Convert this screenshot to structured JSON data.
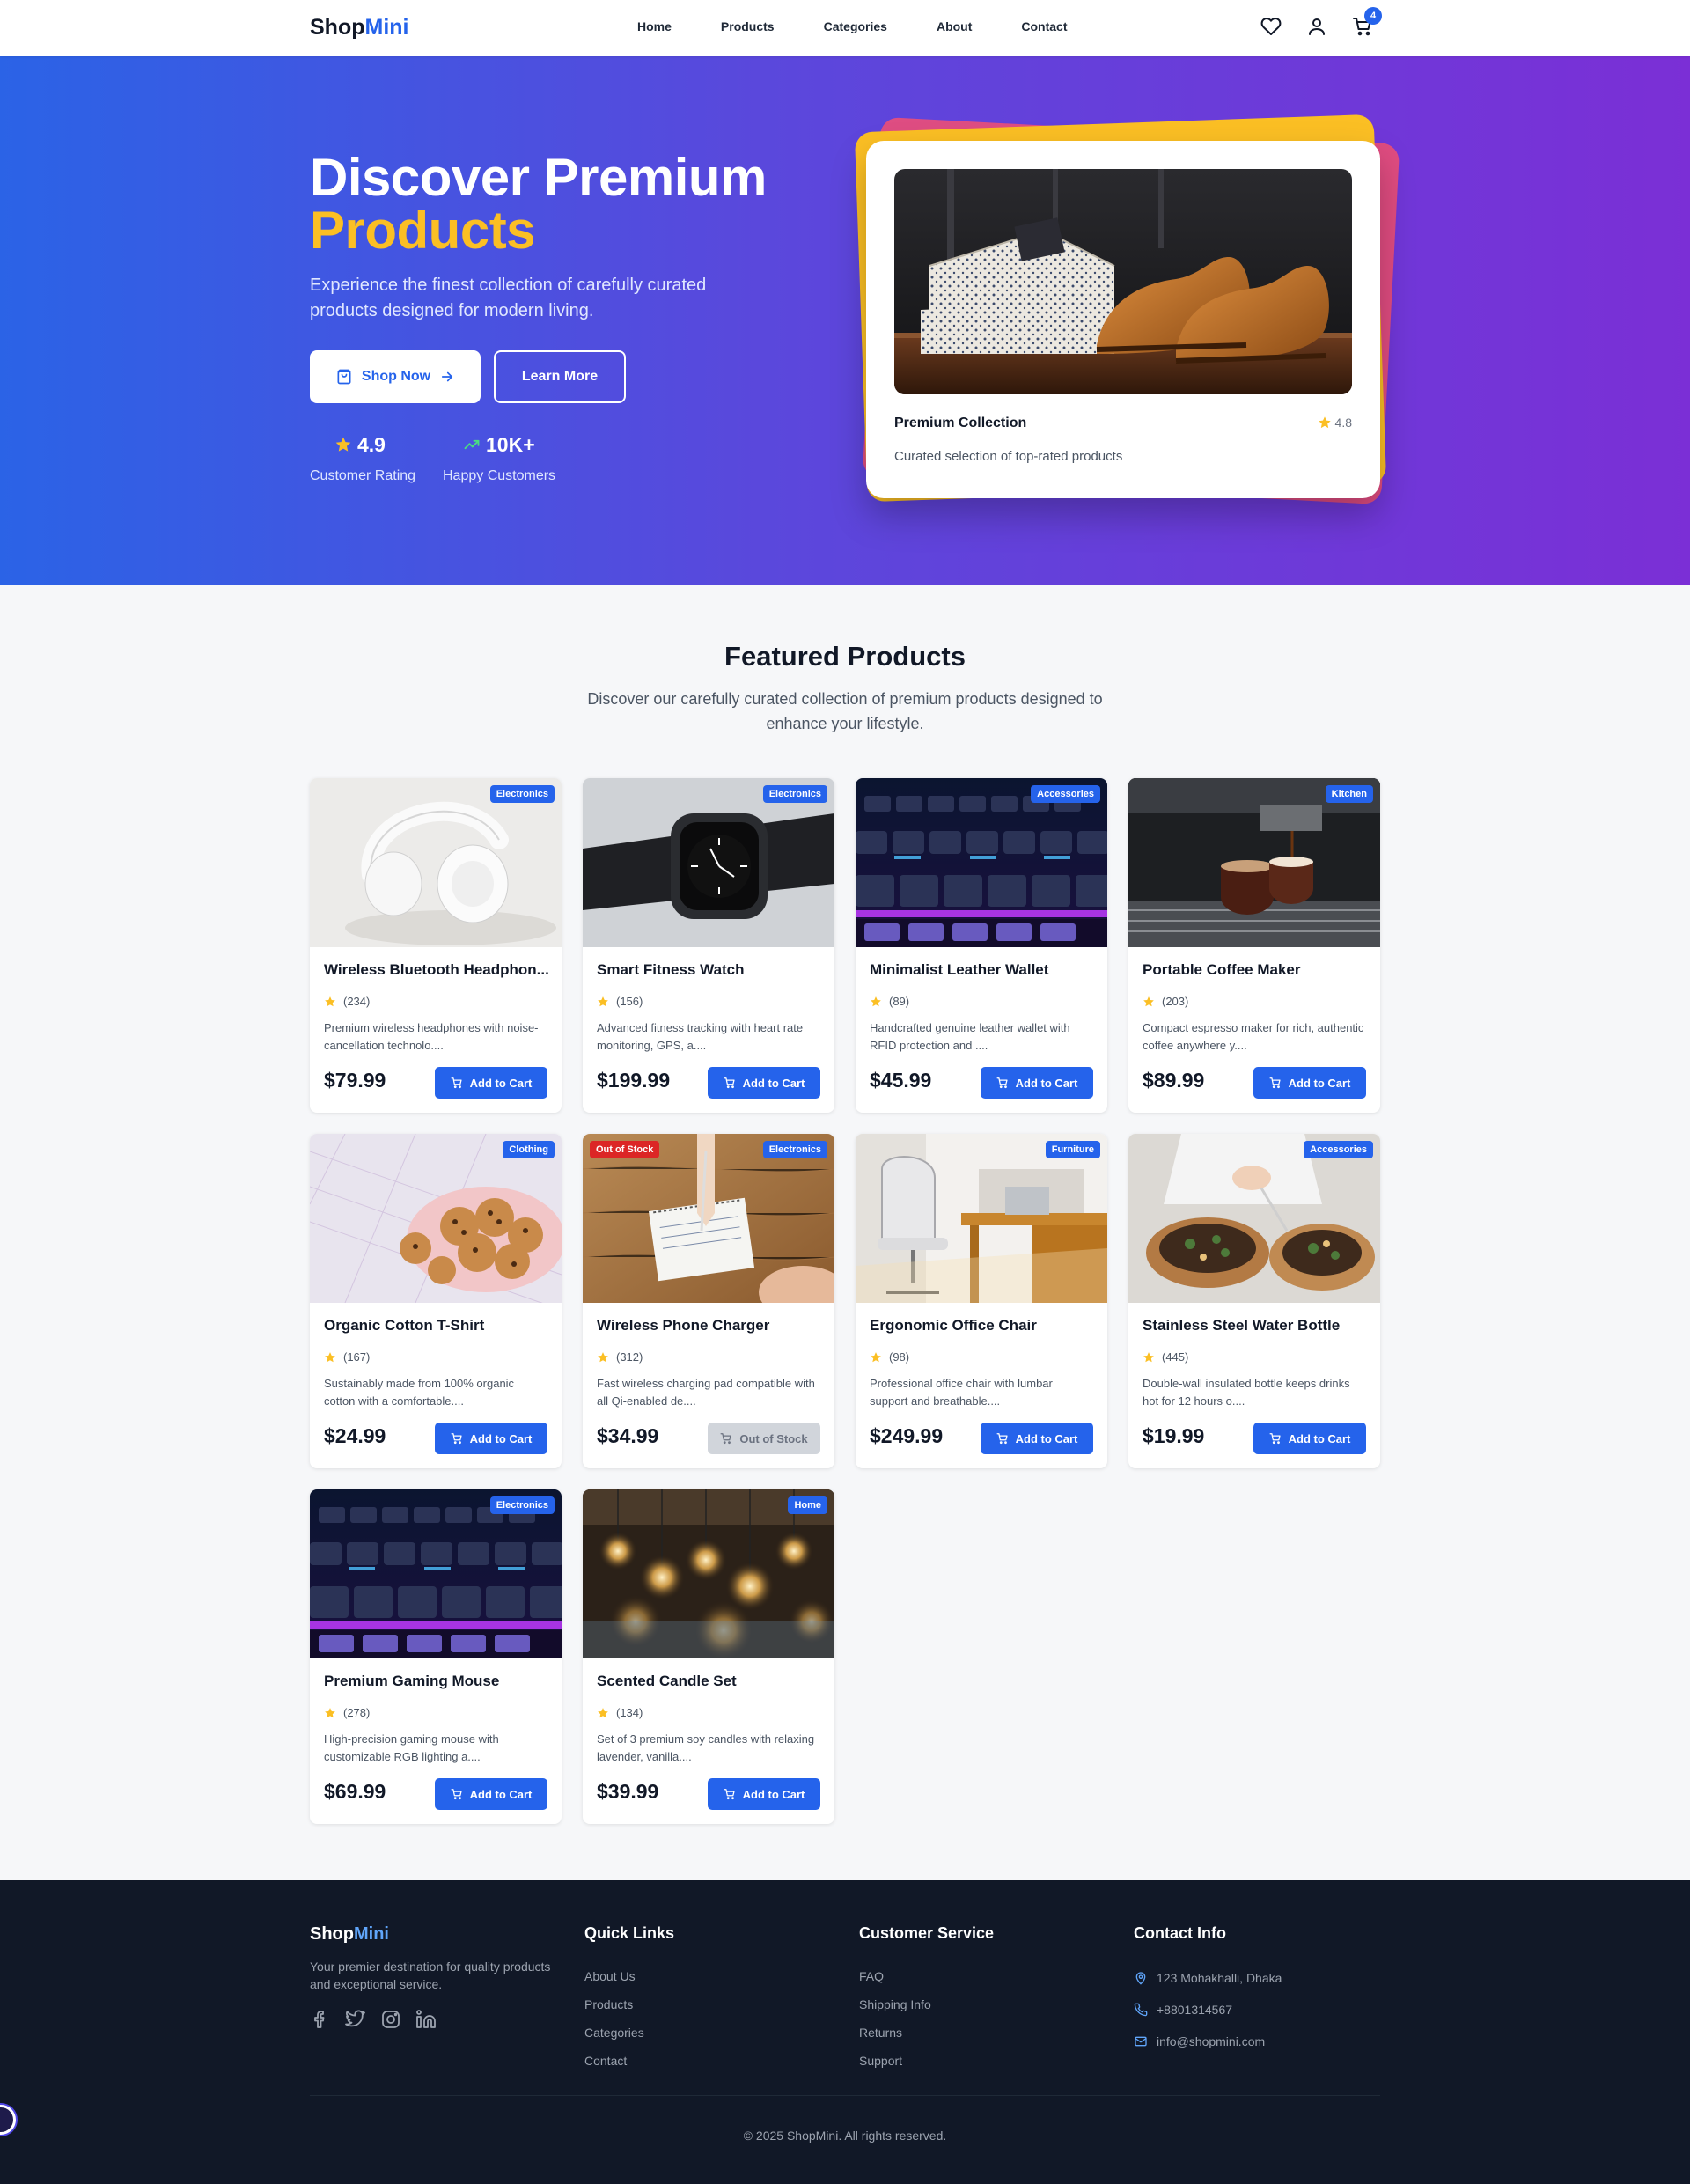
{
  "nav": {
    "logo_part1": "Shop",
    "logo_part2": "Mini",
    "links": [
      "Home",
      "Products",
      "Categories",
      "About",
      "Contact"
    ],
    "cart_count": "4"
  },
  "hero": {
    "title_line1": "Discover Premium",
    "title_line2": "Products",
    "subtitle": "Experience the finest collection of carefully curated products designed for modern living.",
    "shop_now": "Shop Now",
    "learn_more": "Learn More",
    "stat1_value": "4.9",
    "stat1_label": "Customer Rating",
    "stat2_value": "10K+",
    "stat2_label": "Happy Customers",
    "card_title": "Premium Collection",
    "card_rating": "4.8",
    "card_desc": "Curated selection of top-rated products"
  },
  "featured": {
    "title": "Featured Products",
    "subtitle": "Discover our carefully curated collection of premium products designed to enhance your lifestyle."
  },
  "products": [
    {
      "name": "Wireless Bluetooth Headphon...",
      "category": "Electronics",
      "reviews": "(234)",
      "desc": "Premium wireless headphones with noise-cancellation technolo....",
      "price": "$79.99",
      "button": "Add to Cart",
      "oos": "",
      "image": "headphones"
    },
    {
      "name": "Smart Fitness Watch",
      "category": "Electronics",
      "reviews": "(156)",
      "desc": "Advanced fitness tracking with heart rate monitoring, GPS, a....",
      "price": "$199.99",
      "button": "Add to Cart",
      "oos": "",
      "image": "watch"
    },
    {
      "name": "Minimalist Leather Wallet",
      "category": "Accessories",
      "reviews": "(89)",
      "desc": "Handcrafted genuine leather wallet with RFID protection and ....",
      "price": "$45.99",
      "button": "Add to Cart",
      "oos": "",
      "image": "keyboard"
    },
    {
      "name": "Portable Coffee Maker",
      "category": "Kitchen",
      "reviews": "(203)",
      "desc": "Compact espresso maker for rich, authentic coffee anywhere y....",
      "price": "$89.99",
      "button": "Add to Cart",
      "oos": "",
      "image": "coffee"
    },
    {
      "name": "Organic Cotton T-Shirt",
      "category": "Clothing",
      "reviews": "(167)",
      "desc": "Sustainably made from 100% organic cotton with a comfortable....",
      "price": "$24.99",
      "button": "Add to Cart",
      "oos": "",
      "image": "cookies"
    },
    {
      "name": "Wireless Phone Charger",
      "category": "Electronics",
      "reviews": "(312)",
      "desc": "Fast wireless charging pad compatible with all Qi-enabled de....",
      "price": "$34.99",
      "button": "Out of Stock",
      "oos": "Out of Stock",
      "image": "notepad"
    },
    {
      "name": "Ergonomic Office Chair",
      "category": "Furniture",
      "reviews": "(98)",
      "desc": "Professional office chair with lumbar support and breathable....",
      "price": "$249.99",
      "button": "Add to Cart",
      "oos": "",
      "image": "office"
    },
    {
      "name": "Stainless Steel Water Bottle",
      "category": "Accessories",
      "reviews": "(445)",
      "desc": "Double-wall insulated bottle keeps drinks hot for 12 hours o....",
      "price": "$19.99",
      "button": "Add to Cart",
      "oos": "",
      "image": "food"
    },
    {
      "name": "Premium Gaming Mouse",
      "category": "Electronics",
      "reviews": "(278)",
      "desc": "High-precision gaming mouse with customizable RGB lighting a....",
      "price": "$69.99",
      "button": "Add to Cart",
      "oos": "",
      "image": "keyboard"
    },
    {
      "name": "Scented Candle Set",
      "category": "Home",
      "reviews": "(134)",
      "desc": "Set of 3 premium soy candles with relaxing lavender, vanilla....",
      "price": "$39.99",
      "button": "Add to Cart",
      "oos": "",
      "image": "bulbs"
    }
  ],
  "footer": {
    "logo_part1": "Shop",
    "logo_part2": "Mini",
    "tagline": "Your premier destination for quality products and exceptional service.",
    "quick_links_title": "Quick Links",
    "quick_links": [
      "About Us",
      "Products",
      "Categories",
      "Contact"
    ],
    "service_title": "Customer Service",
    "service_links": [
      "FAQ",
      "Shipping Info",
      "Returns",
      "Support"
    ],
    "contact_title": "Contact Info",
    "address": "123 Mohakhalli, Dhaka",
    "phone": "+8801314567",
    "email": "info@shopmini.com",
    "copyright": "© 2025 ShopMini. All rights reserved."
  },
  "colors": {
    "brand_blue": "#2563eb",
    "accent_yellow": "#fbbf24",
    "footer_bg": "#111827",
    "oos_red": "#dc2626"
  }
}
